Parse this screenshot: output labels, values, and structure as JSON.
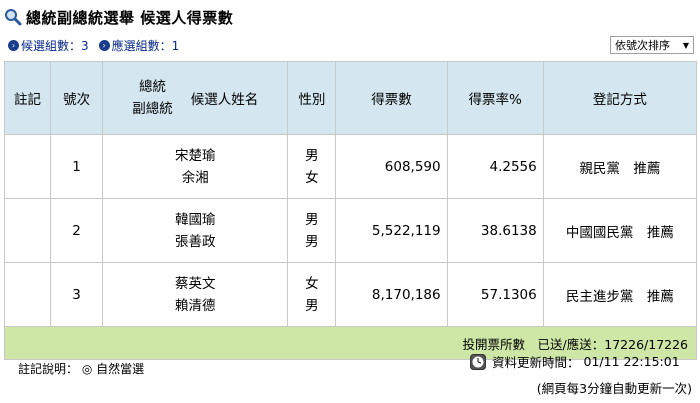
{
  "header": {
    "title": "總統副總統選舉 候選人得票數",
    "candidate_count_label": "候選組數：",
    "candidate_count_value": "3",
    "elected_count_label": "應選組數：",
    "elected_count_value": "1",
    "sort_select_value": "依號次排序"
  },
  "table": {
    "headers": {
      "note": "註記",
      "number": "號次",
      "role_president": "總統",
      "role_vice": "副總統",
      "name": "候選人姓名",
      "gender": "性別",
      "votes": "得票數",
      "rate": "得票率%",
      "registration": "登記方式"
    },
    "rows": [
      {
        "note": "",
        "number": "1",
        "president": "宋楚瑜",
        "vice": "余湘",
        "gender_p": "男",
        "gender_v": "女",
        "votes": "608,590",
        "rate": "4.2556",
        "registration": "親民黨　推薦"
      },
      {
        "note": "",
        "number": "2",
        "president": "韓國瑜",
        "vice": "張善政",
        "gender_p": "男",
        "gender_v": "男",
        "votes": "5,522,119",
        "rate": "38.6138",
        "registration": "中國國民黨　推薦"
      },
      {
        "note": "",
        "number": "3",
        "president": "蔡英文",
        "vice": "賴清德",
        "gender_p": "女",
        "gender_v": "男",
        "votes": "8,170,186",
        "rate": "57.1306",
        "registration": "民主進步黨　推薦"
      }
    ],
    "footer": "投開票所數　已送/應送：17226/17226"
  },
  "notes": {
    "legend": "註記說明：",
    "legend_item": "◎ 自然當選",
    "update_label": "資料更新時間：",
    "update_time": "01/11 22:15:01",
    "auto_refresh": "(網頁每3分鐘自動更新一次)"
  },
  "colors": {
    "header_bg": "#d4e6ef",
    "footer_bg": "#cfe7a6",
    "bullet": "#1b3e8c"
  }
}
